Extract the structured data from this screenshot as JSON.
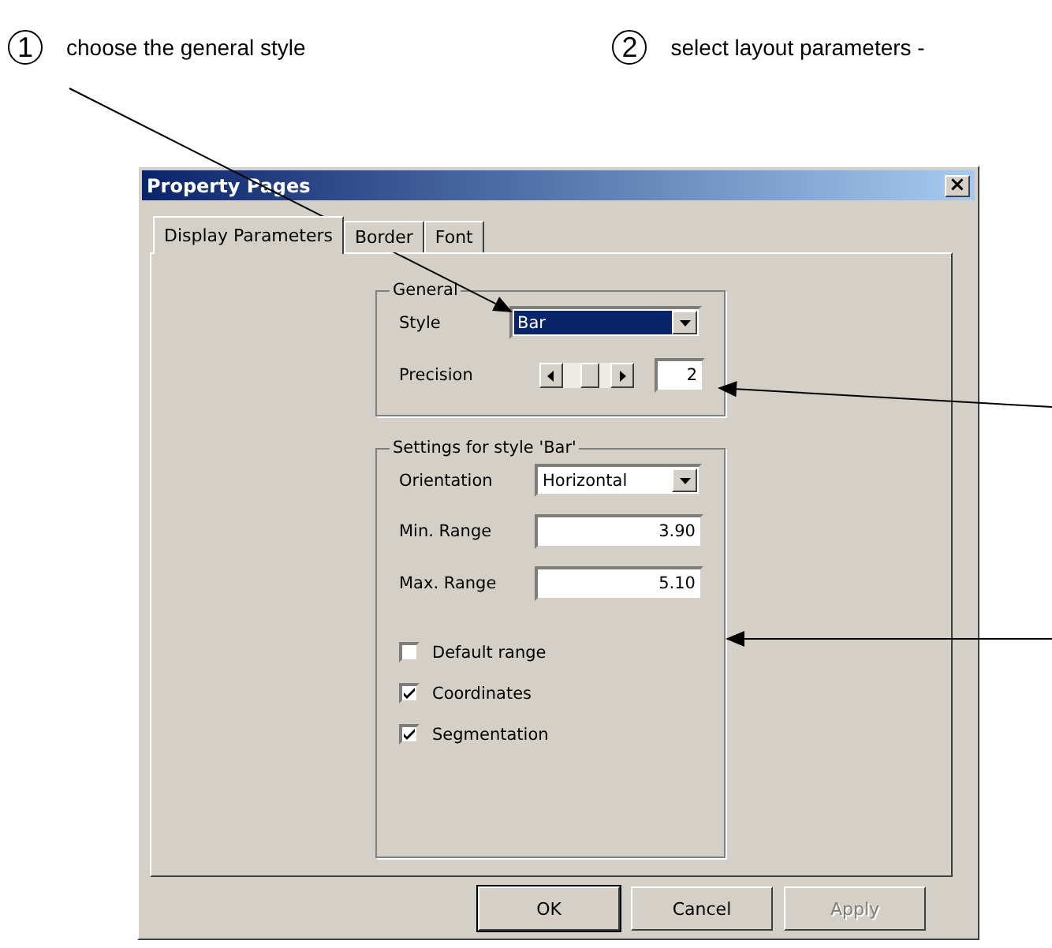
{
  "callouts": [
    {
      "number": "1",
      "text": "choose the general style"
    },
    {
      "number": "2",
      "text": "select layout parameters -"
    }
  ],
  "window": {
    "title": "Property Pages",
    "close": "×"
  },
  "tabs": [
    {
      "label": "Display Parameters",
      "selected": true
    },
    {
      "label": "Border",
      "selected": false
    },
    {
      "label": "Font",
      "selected": false
    }
  ],
  "general": {
    "legend": "General",
    "style": {
      "label": "Style",
      "value": "Bar"
    },
    "precision": {
      "label": "Precision",
      "level": 0.55,
      "value": "2"
    }
  },
  "settings": {
    "legend": "Settings for style 'Bar'",
    "orientation": {
      "label": "Orientation",
      "value": "Horizontal"
    },
    "fields": [
      {
        "label": "Min. Range",
        "value": "3.90"
      },
      {
        "label": "Max. Range",
        "value": "5.10"
      }
    ],
    "checkboxes": [
      {
        "label": "Default range",
        "checked": false
      },
      {
        "label": "Coordinates",
        "checked": true
      },
      {
        "label": "Segmentation",
        "checked": true
      }
    ]
  },
  "buttons": [
    {
      "label": "OK",
      "default": true,
      "disabled": false
    },
    {
      "label": "Cancel",
      "default": false,
      "disabled": false
    },
    {
      "label": "Apply",
      "default": false,
      "disabled": true
    }
  ]
}
